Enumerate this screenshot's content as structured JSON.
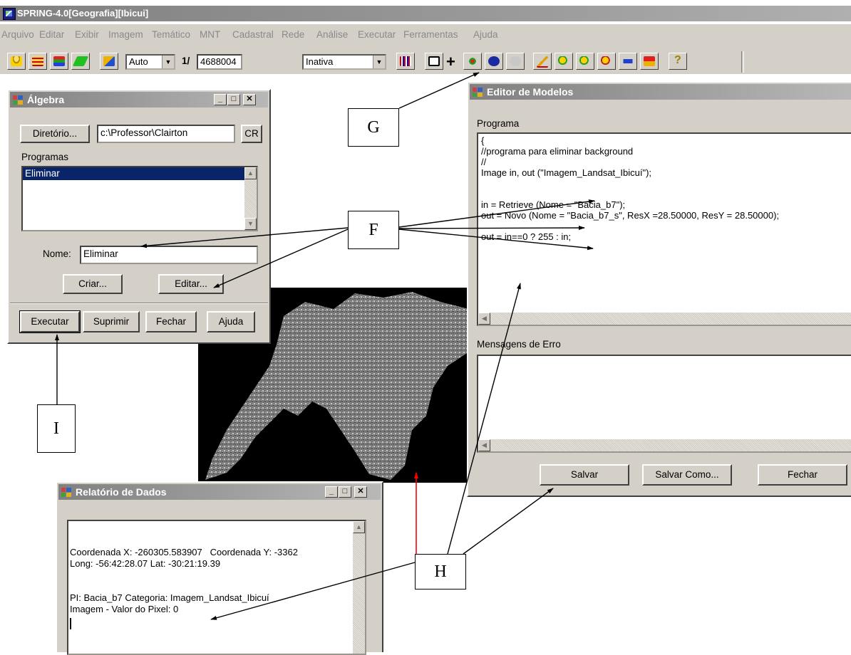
{
  "app": {
    "title": "SPRING-4.0[Geografia][Ibicui]"
  },
  "menu": [
    "Arquivo",
    "Editar",
    "Exibir",
    "Imagem",
    "Temático",
    "MNT",
    "Cadastral",
    "Rede",
    "Análise",
    "Executar",
    "Ferramentas",
    "Ajuda"
  ],
  "toolbar": {
    "zoom_mode": "Auto",
    "scale_prefix": "1/",
    "scale_value": "4688004",
    "state": "Inativa",
    "add_symbol": "+",
    "help_symbol": "?"
  },
  "algebra": {
    "title": "Álgebra",
    "dir_button": "Diretório...",
    "dir_value": "c:\\Professor\\Clairton",
    "cr_button": "CR",
    "programs_label": "Programas",
    "programs": [
      "Eliminar"
    ],
    "name_label": "Nome:",
    "name_value": "Eliminar",
    "create_button": "Criar...",
    "edit_button": "Editar...",
    "run_button": "Executar",
    "delete_button": "Suprimir",
    "close_button": "Fechar",
    "help_button": "Ajuda"
  },
  "editor": {
    "title": "Editor de Modelos",
    "program_label": "Programa",
    "code_lines": [
      "{",
      "//programa para eliminar background",
      "//",
      "Image in, out (\"Imagem_Landsat_Ibicuí\");",
      "",
      "",
      "in = Retrieve (Nome = \"Bacia_b7\");",
      "out = Novo (Nome = \"Bacia_b7_s\", ResX =28.50000, ResY = 28.50000);",
      "",
      "out = in==0 ? 255 : in;"
    ],
    "errors_label": "Mensagens de Erro",
    "save_button": "Salvar",
    "save_as_button": "Salvar Como...",
    "close_button": "Fechar"
  },
  "report": {
    "title": "Relatório de Dados",
    "lines": [
      "Coordenada X: -260305.583907   Coordenada Y: -3362",
      "Long: -56:42:28.07 Lat: -30:21:19.39",
      "",
      "",
      "PI: Bacia_b7 Categoria: Imagem_Landsat_Ibicuí",
      "Imagem - Valor do Pixel: 0"
    ]
  },
  "annotations": {
    "g": "G",
    "f": "F",
    "h": "H",
    "i": "I"
  },
  "colors": {
    "title_bar": "#808080",
    "selection": "#0a246a",
    "image_bg": "#000000",
    "red_arrow": "#ff0000"
  },
  "icons": [
    "database-icon",
    "table-icon",
    "layers-icon",
    "draw-icon",
    "cursor-icon",
    "color-table-icon",
    "import-icon",
    "pan-icon",
    "info-icon",
    "query-icon",
    "edit-line-icon",
    "zoom-in-icon",
    "zoom-out-icon",
    "zoom-area-icon",
    "back-icon",
    "undo-icon",
    "help-icon"
  ]
}
